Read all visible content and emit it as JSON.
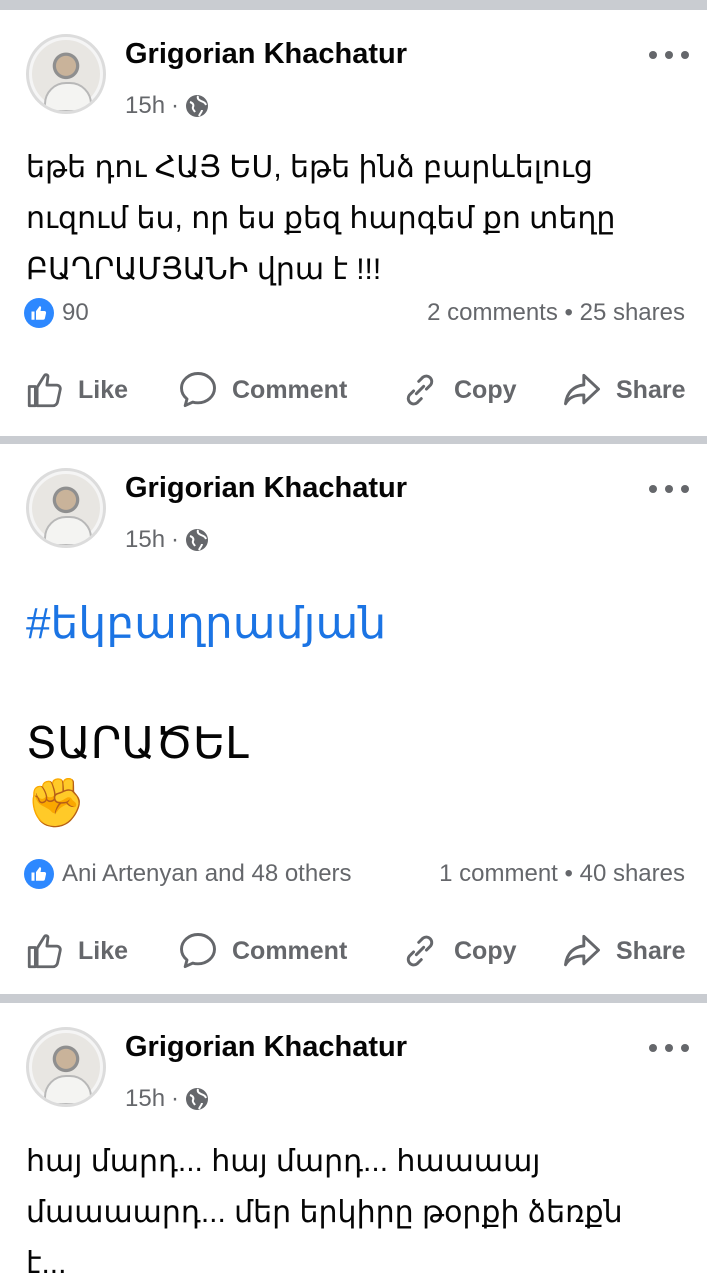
{
  "posts": [
    {
      "author": "Grigorian Khachatur",
      "time": "15h",
      "separator": "·",
      "text_lines": [
        "եթե դու ՀԱՅ ԵՍ, եթե ինձ բարևելուց",
        "ուզում ես, որ ես քեզ հարգեմ քո տեղը",
        "ԲԱՂՐԱՄՅԱՆԻ վրա է !!!"
      ],
      "reactions": "90",
      "comments": "2 comments",
      "shares": "25 shares",
      "dot": "•"
    },
    {
      "author": "Grigorian Khachatur",
      "time": "15h",
      "separator": "·",
      "hashtag": "#եկբաղրամյան",
      "big_text": "ՏԱՐԱԾԵԼ",
      "emoji": "✊",
      "reactions": "Ani Artenyan and 48 others",
      "comments": "1 comment",
      "shares": "40 shares",
      "dot": "•"
    },
    {
      "author": "Grigorian Khachatur",
      "time": "15h",
      "separator": "·",
      "text_lines": [
        "հայ մարդ... հայ մարդ... հաաաայ",
        "մաաաարդ... մեր երկիրը թօրքի ձեռքն",
        "է..."
      ]
    }
  ],
  "actions": {
    "like": "Like",
    "comment": "Comment",
    "copy": "Copy",
    "share": "Share"
  },
  "colors": {
    "accent": "#1b74e4",
    "like_badge": "#2d88ff",
    "secondary_text": "#65676b",
    "divider": "#c9ccd1"
  },
  "icons": [
    "more-options-icon",
    "globe-icon",
    "like-reaction-icon",
    "like-icon",
    "comment-icon",
    "copy-link-icon",
    "share-icon"
  ]
}
